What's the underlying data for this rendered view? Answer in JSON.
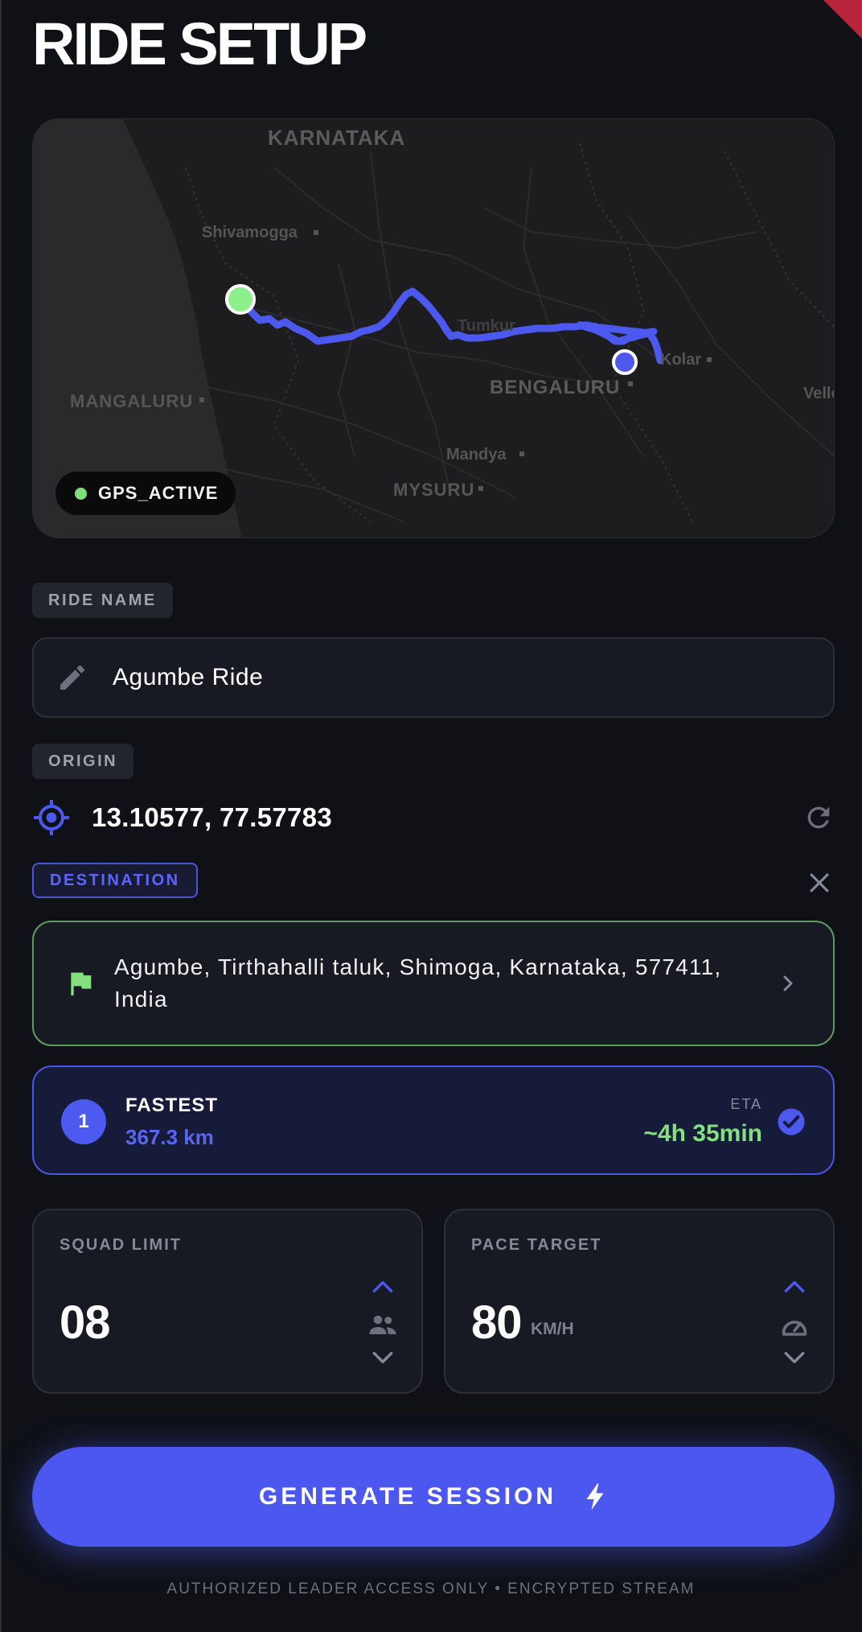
{
  "page": {
    "title": "RIDE SETUP"
  },
  "map": {
    "labels": {
      "karnataka": "KARNATAKA",
      "shivamogga": "Shivamogga",
      "mangaluru": "MANGALURU",
      "tumkur": "Tumkur",
      "bengaluru": "BENGALURU",
      "kolar": "Kolar",
      "vellore": "Vello",
      "mandya": "Mandya",
      "mysuru": "MYSURU"
    },
    "gps_status": "GPS_ACTIVE",
    "colors": {
      "route": "#4c58ee",
      "start_marker": "#8ef08a",
      "end_marker": "#4c58ee",
      "gps_dot": "#7ee07a"
    }
  },
  "ride_name": {
    "label": "RIDE NAME",
    "value": "Agumbe Ride",
    "icon": "pencil-icon"
  },
  "origin": {
    "label": "ORIGIN",
    "value": "13.10577, 77.57783",
    "icon": "crosshair-target-icon",
    "action_icon": "refresh-icon"
  },
  "destination": {
    "label": "DESTINATION",
    "clear_icon": "close-icon",
    "address": "Agumbe, Tirthahalli taluk, Shimoga, Karnataka, 577411, India",
    "icon": "flag-icon",
    "accent": "#5d9a5f"
  },
  "route": {
    "index": "1",
    "name": "FASTEST",
    "distance": "367.3 km",
    "eta_label": "ETA",
    "eta_value": "~4h 35min",
    "selected": true,
    "accent": "#4a55e0"
  },
  "squad_limit": {
    "label": "SQUAD LIMIT",
    "value": "08",
    "icon": "users-icon"
  },
  "pace_target": {
    "label": "PACE TARGET",
    "value": "80",
    "unit": "KM/H",
    "icon": "speedometer-icon"
  },
  "generate_button": {
    "label": "GENERATE SESSION",
    "icon": "lightning-bolt-icon",
    "color": "#4b57ee"
  },
  "footer": {
    "text": "AUTHORIZED LEADER ACCESS ONLY  •  ENCRYPTED STREAM"
  }
}
